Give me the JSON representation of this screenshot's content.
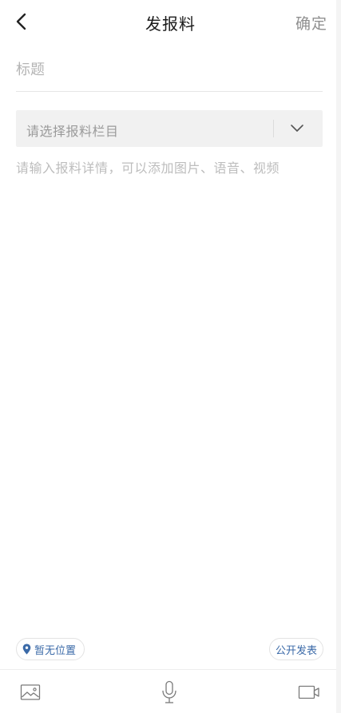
{
  "header": {
    "title": "发报料",
    "confirm_label": "确定",
    "back_icon": "chevron-left-icon"
  },
  "form": {
    "title_placeholder": "标题",
    "title_value": "",
    "category_placeholder": "请选择报料栏目",
    "content_placeholder": "请输入报料详情，可以添加图片、语音、视频",
    "content_value": ""
  },
  "bottom": {
    "location_label": "暂无位置",
    "public_label": "公开发表"
  },
  "toolbar": {
    "image_icon": "image-icon",
    "voice_icon": "microphone-icon",
    "video_icon": "video-camera-icon"
  },
  "colors": {
    "accent_blue": "#3b6aa8",
    "placeholder_gray": "#b4b4b4",
    "select_bg": "#f1f1f1"
  }
}
